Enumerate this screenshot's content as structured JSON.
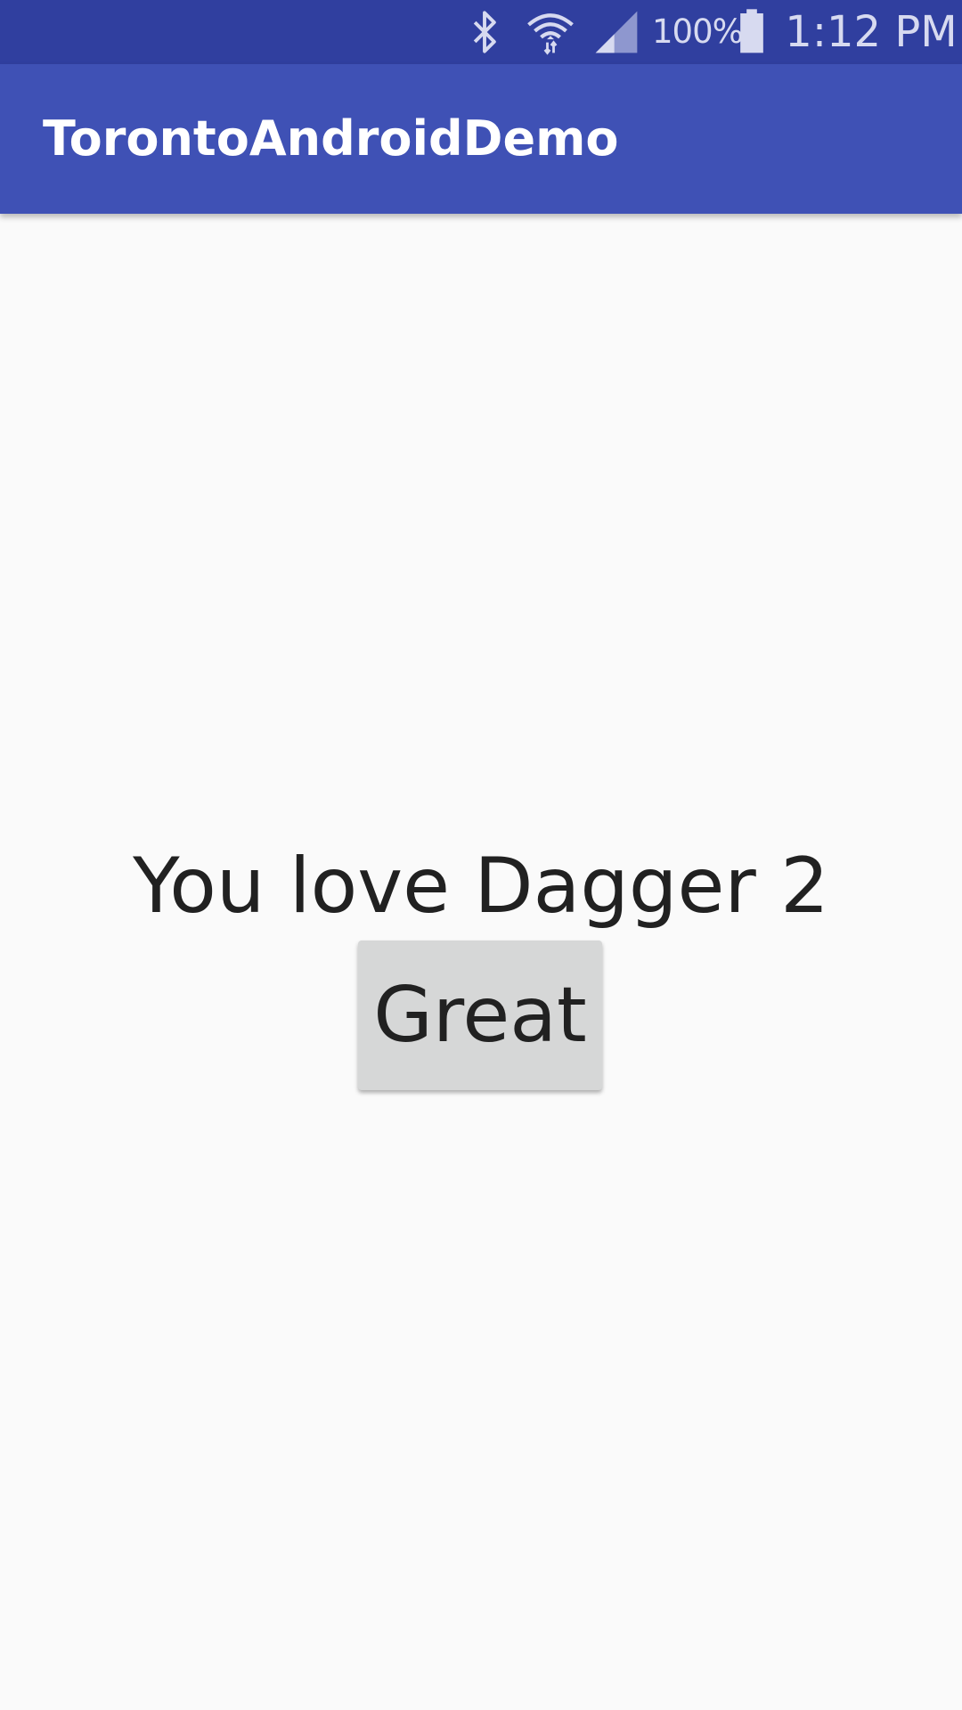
{
  "status_bar": {
    "icons": [
      "bluetooth-icon",
      "wifi-icon",
      "cell-signal-icon",
      "battery-icon"
    ],
    "battery_percent": "100%",
    "time": "1:12 PM",
    "color": "#303f9f"
  },
  "app_bar": {
    "title": "TorontoAndroidDemo",
    "color": "#3f51b5"
  },
  "main": {
    "message": "You love Dagger 2",
    "button_label": "Great",
    "background": "#fafafa"
  }
}
